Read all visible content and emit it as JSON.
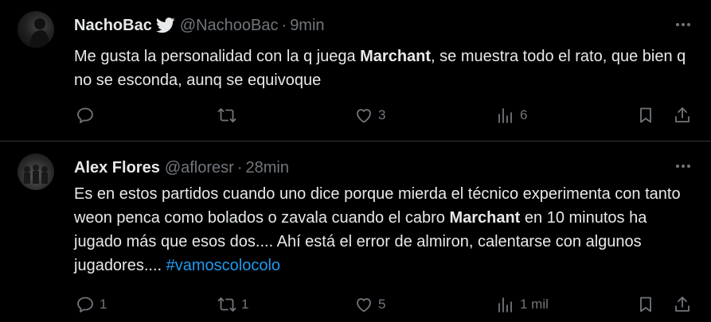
{
  "tweets": [
    {
      "name": "NachoBac",
      "handle": "@NachooBac",
      "separator": "·",
      "time": "9min",
      "text_parts": [
        "Me gusta la personalidad con la q juega ",
        "Marchant",
        ", se muestra todo el rato, que bien q no se esconda, aunq se equivoque"
      ],
      "replies": "",
      "retweets": "",
      "likes": "3",
      "views": "6"
    },
    {
      "name": "Alex Flores",
      "handle": "@afloresr",
      "separator": "·",
      "time": "28min",
      "text_parts": [
        "Es en estos partidos cuando uno dice porque mierda el técnico experimenta con tanto weon penca como bolados o zavala cuando el cabro ",
        "Marchant",
        " en 10 minutos ha jugado más que esos dos.... Ahí está el error de almiron, calentarse con algunos jugadores.... "
      ],
      "hashtag": "#vamoscolocolo",
      "replies": "1",
      "retweets": "1",
      "likes": "5",
      "views": "1 mil"
    }
  ],
  "colors": {
    "background": "#000000",
    "text": "#e7e9ea",
    "muted": "#71767b",
    "link": "#1d9bf0",
    "divider": "#2f3336"
  },
  "icons": [
    "verified-icon",
    "more-icon",
    "reply-icon",
    "retweet-icon",
    "like-icon",
    "views-icon",
    "bookmark-icon",
    "share-icon"
  ]
}
